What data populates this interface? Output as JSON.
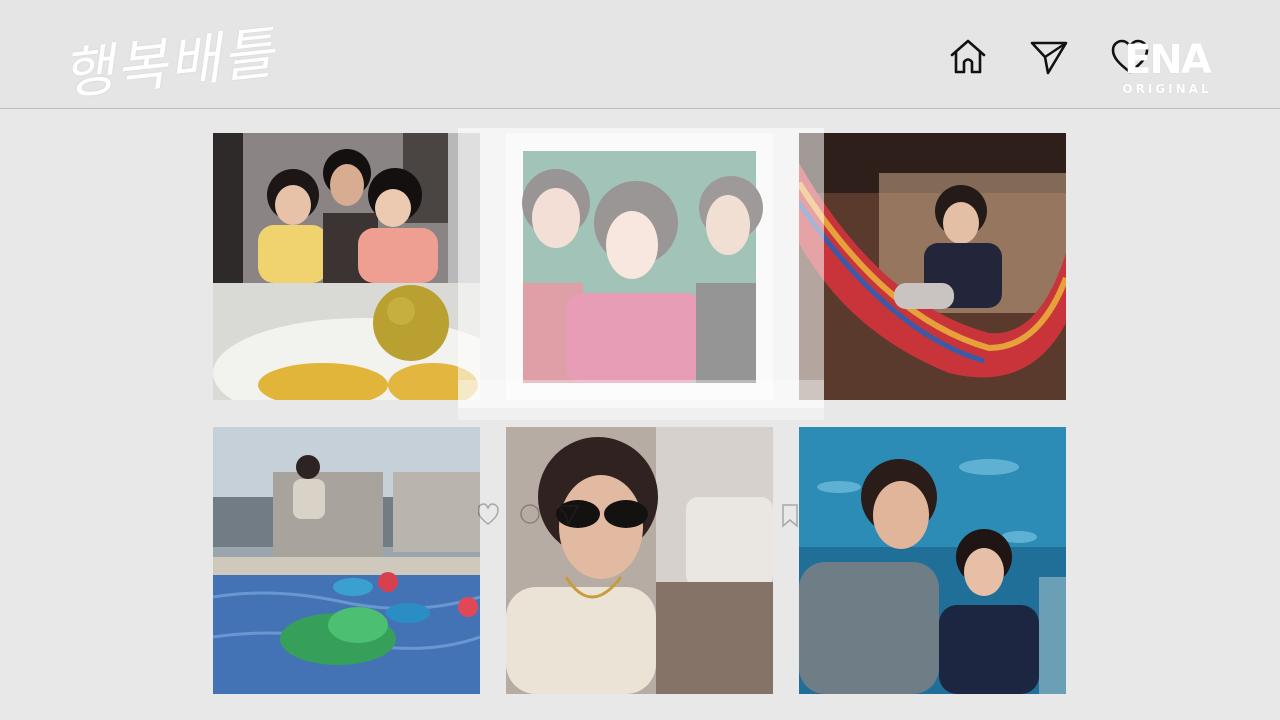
{
  "app": {
    "title_logo": "행복배틀",
    "brand_main": "ENA",
    "brand_sub": "ORIGINAL"
  },
  "nav": {
    "items": [
      {
        "name": "home",
        "icon": "home-icon"
      },
      {
        "name": "send",
        "icon": "paper-plane-icon"
      },
      {
        "name": "likes",
        "icon": "heart-icon"
      }
    ]
  },
  "feed": {
    "photos": [
      {
        "subject": "family-selfie-and-fruit",
        "icon": "photo-collage"
      },
      {
        "subject": "three-women-portrait",
        "icon": "photo-framed"
      },
      {
        "subject": "boy-in-hammock",
        "icon": "photo"
      },
      {
        "subject": "rooftop-pool-with-kids",
        "icon": "photo"
      },
      {
        "subject": "woman-in-sunglasses-selfie",
        "icon": "photo"
      },
      {
        "subject": "mother-and-son-at-aquarium",
        "icon": "photo"
      }
    ]
  },
  "colors": {
    "background": "#e8e8e9",
    "topbar": "#e5e5e6",
    "icon_stroke": "#111111",
    "logo_text": "#ffffff"
  }
}
